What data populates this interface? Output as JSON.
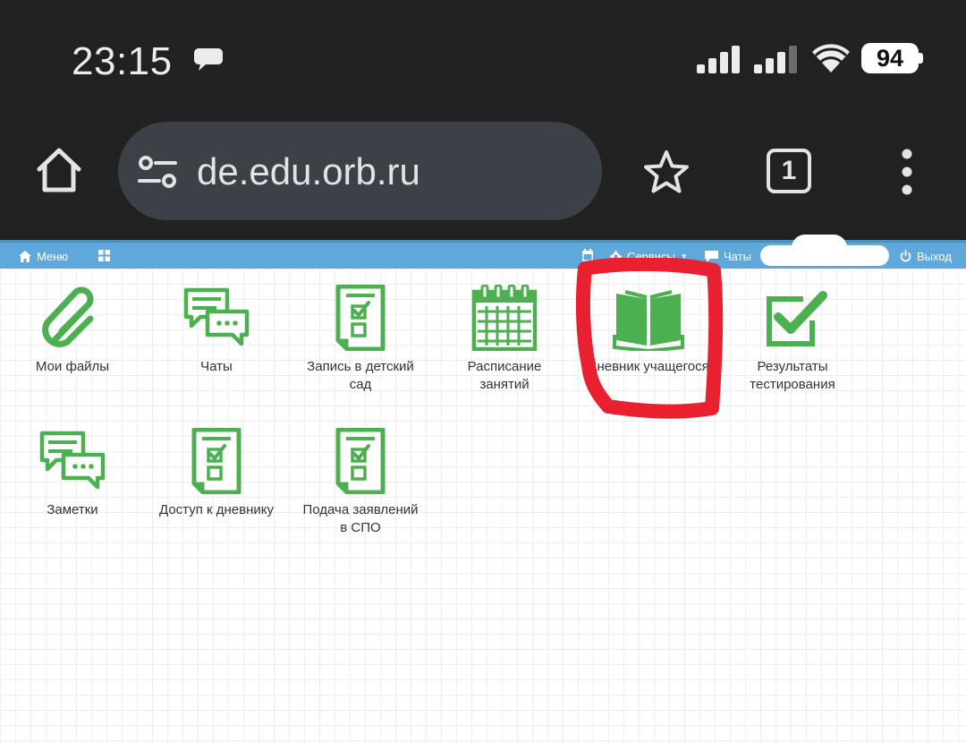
{
  "status_bar": {
    "time": "23:15",
    "battery": "94"
  },
  "browser": {
    "url": "de.edu.orb.ru",
    "tab_count": "1"
  },
  "site_nav": {
    "menu_label": "Меню",
    "services_label": "Сервисы",
    "chats_label": "Чаты",
    "logout_label": "Выход"
  },
  "tiles": [
    {
      "label": "Мои файлы",
      "icon": "paperclip-icon"
    },
    {
      "label": "Чаты",
      "icon": "chat-bubbles-icon"
    },
    {
      "label": "Запись в детский сад",
      "icon": "checklist-document-icon"
    },
    {
      "label": "Расписание занятий",
      "icon": "calendar-icon"
    },
    {
      "label": "Дневник учащегося",
      "icon": "open-book-icon"
    },
    {
      "label": "Результаты тестирования",
      "icon": "checkbox-checked-icon"
    },
    {
      "label": "Заметки",
      "icon": "chat-bubbles-icon"
    },
    {
      "label": "Доступ к дневнику",
      "icon": "checklist-document-icon"
    },
    {
      "label": "Подача заявлений в СПО",
      "icon": "checklist-document-icon"
    }
  ],
  "colors": {
    "header": "#5ea8dc",
    "icon_green": "#4caf50",
    "annotation": "#e8202f",
    "chrome": "#212121"
  }
}
